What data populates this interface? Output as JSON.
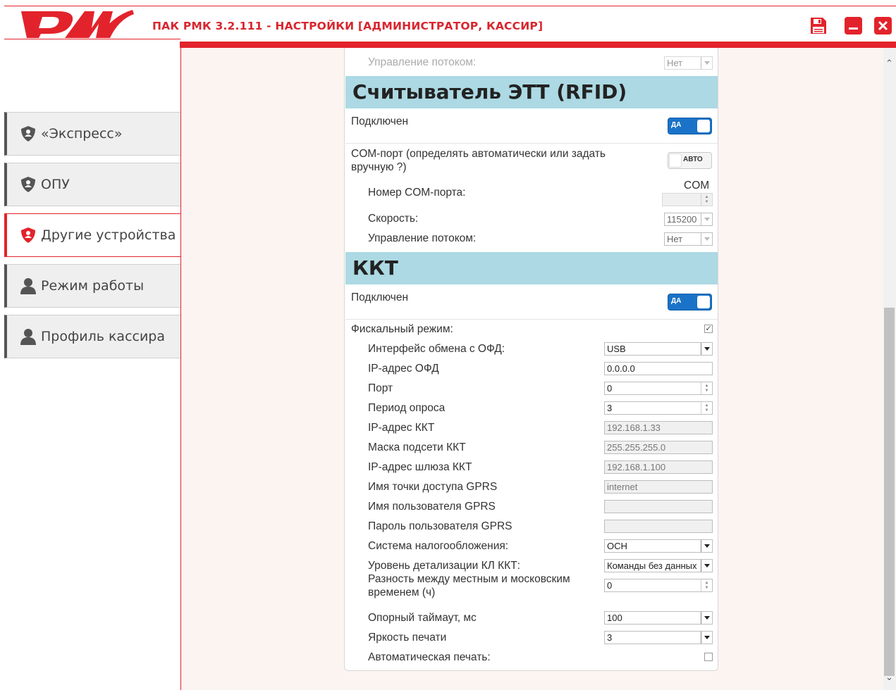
{
  "app": {
    "logo_text": "РЖД",
    "title": "ПАК РМК  3.2.111 - НАСТРОЙКИ [АДМИНИСТРАТОР, КАССИР]",
    "brand_color": "#e3232b",
    "controls": [
      {
        "name": "save",
        "icon": "save-icon"
      },
      {
        "name": "minimize",
        "icon": "minimize-icon"
      },
      {
        "name": "close",
        "icon": "close-icon"
      }
    ]
  },
  "sidebar": {
    "items": [
      {
        "label": "«Экспресс»",
        "icon": "shield-icon",
        "active": false
      },
      {
        "label": "ОПУ",
        "icon": "shield-icon",
        "active": false
      },
      {
        "label": "Другие устройства",
        "icon": "shield-icon",
        "active": true
      },
      {
        "label": "Режим работы",
        "icon": "user-icon",
        "active": false
      },
      {
        "label": "Профиль кассира",
        "icon": "user-icon",
        "active": false
      }
    ]
  },
  "top_partial": {
    "label": "Управление потоком:",
    "value": "Нет"
  },
  "rfid": {
    "heading": "Считыватель ЭТТ (RFID)",
    "connected_label": "Подключен",
    "connected_toggle": "ДА",
    "com_auto_label": "COM-порт (определять автоматически или задать вручную ?)",
    "com_auto_toggle": "АВТО",
    "com_number_label": "Номер COM-порта:",
    "com_prefix": "COM",
    "com_number_value": "",
    "speed_label": "Скорость:",
    "speed_value": "115200",
    "flow_label": "Управление потоком:",
    "flow_value": "Нет"
  },
  "kkt": {
    "heading": "ККТ",
    "connected_label": "Подключен",
    "connected_toggle": "ДА",
    "fiscal_label": "Фискальный режим:",
    "fiscal_checked": true,
    "auto_print_label": "Автоматическая печать:",
    "auto_print_checked": false,
    "fields": [
      {
        "label": "Интерфейс обмена с ОФД:",
        "value": "USB",
        "kind": "select"
      },
      {
        "label": "IP-адрес ОФД",
        "value": "0.0.0.0",
        "kind": "text"
      },
      {
        "label": "Порт",
        "value": "0",
        "kind": "spin"
      },
      {
        "label": "Период опроса",
        "value": "3",
        "kind": "spin"
      },
      {
        "label": "IP-адрес ККТ",
        "value": "192.168.1.33",
        "kind": "readonly"
      },
      {
        "label": "Маска подсети ККТ",
        "value": "255.255.255.0",
        "kind": "readonly"
      },
      {
        "label": "IP-адрес шлюза ККТ",
        "value": "192.168.1.100",
        "kind": "readonly"
      },
      {
        "label": "Имя точки доступа GPRS",
        "value": "internet",
        "kind": "readonly"
      },
      {
        "label": "Имя пользователя GPRS",
        "value": "",
        "kind": "readonly"
      },
      {
        "label": "Пароль пользователя GPRS",
        "value": "",
        "kind": "readonly"
      },
      {
        "label": "Система налогообложения:",
        "value": "ОСН",
        "kind": "select"
      },
      {
        "label": "Уровень детализации КЛ ККТ:",
        "value": "Команды без данных",
        "kind": "select"
      },
      {
        "label": "Разность между местным и московским временем (ч)",
        "value": "0",
        "kind": "spin"
      },
      {
        "label": "Опорный таймаут, мс",
        "value": "100",
        "kind": "select"
      },
      {
        "label": "Яркость печати",
        "value": "3",
        "kind": "select"
      }
    ]
  }
}
